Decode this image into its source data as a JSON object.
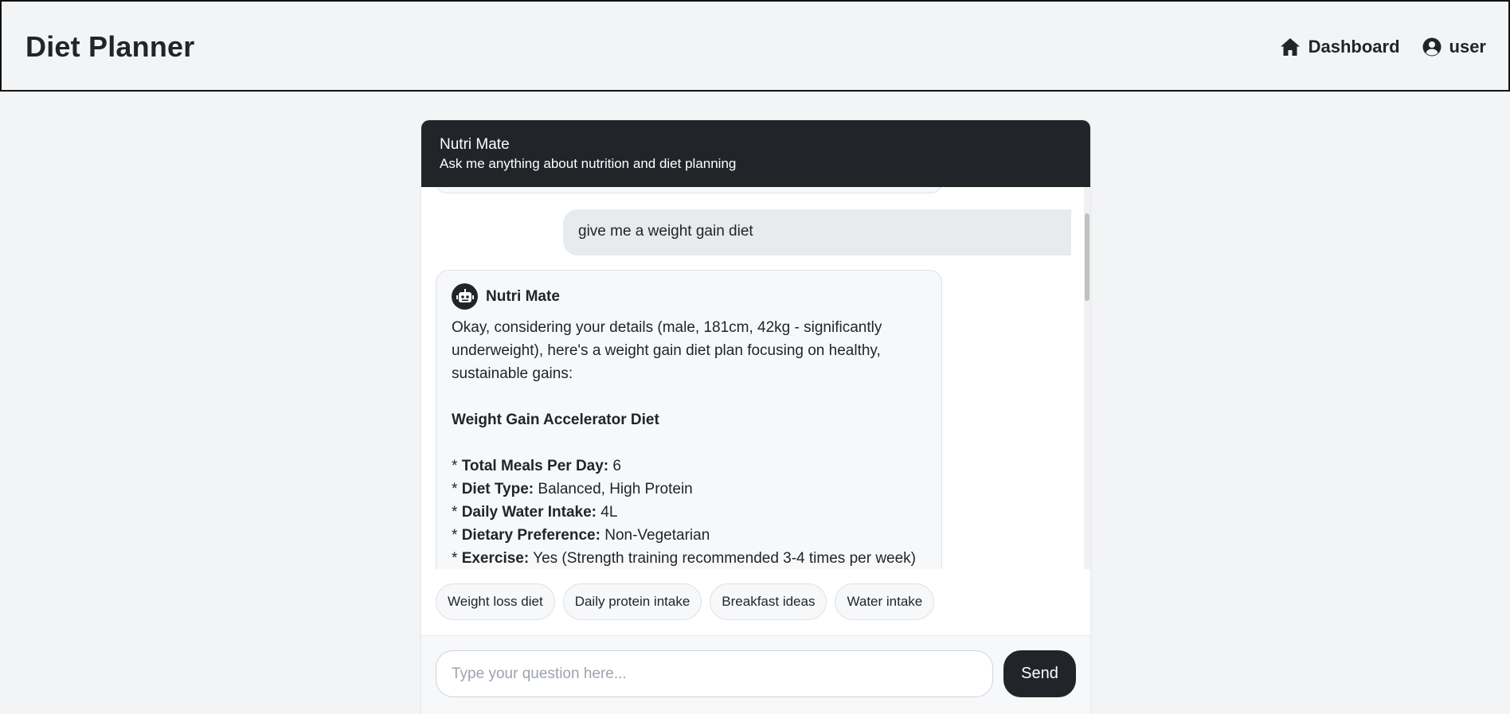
{
  "app": {
    "brand": "Diet Planner",
    "nav": {
      "dashboard_label": "Dashboard",
      "user_label": "user"
    }
  },
  "chat": {
    "title": "Nutri Mate",
    "subtitle": "Ask me anything about nutrition and diet planning",
    "messages": {
      "user_message": "give me a weight gain diet",
      "bot": {
        "name": "Nutri Mate",
        "intro": "Okay, considering your details (male, 181cm, 42kg - significantly underweight), here's a weight gain diet plan focusing on healthy, sustainable gains:",
        "plan_title": "Weight Gain Accelerator Diet",
        "items": [
          {
            "bullet": "* ",
            "label": "Total Meals Per Day:",
            "value": " 6"
          },
          {
            "bullet": "* ",
            "label": "Diet Type:",
            "value": " Balanced, High Protein"
          },
          {
            "bullet": "* ",
            "label": "Daily Water Intake:",
            "value": " 4L"
          },
          {
            "bullet": "* ",
            "label": "Dietary Preference:",
            "value": " Non-Vegetarian"
          },
          {
            "bullet": "* ",
            "label": "Exercise:",
            "value": " Yes (Strength training recommended 3-4 times per week)"
          }
        ]
      }
    },
    "suggestions": [
      "Weight loss diet",
      "Daily protein intake",
      "Breakfast ideas",
      "Water intake"
    ],
    "input": {
      "placeholder": "Type your question here...",
      "value": ""
    },
    "send_label": "Send"
  },
  "icons": {
    "dashboard": "home-icon",
    "user": "user-circle-icon",
    "bot": "robot-icon"
  },
  "colors": {
    "header_dark": "#212529",
    "page_bg": "#f3f4f6",
    "user_bubble": "#e8ebee",
    "bot_bubble": "#f7f8fa"
  }
}
